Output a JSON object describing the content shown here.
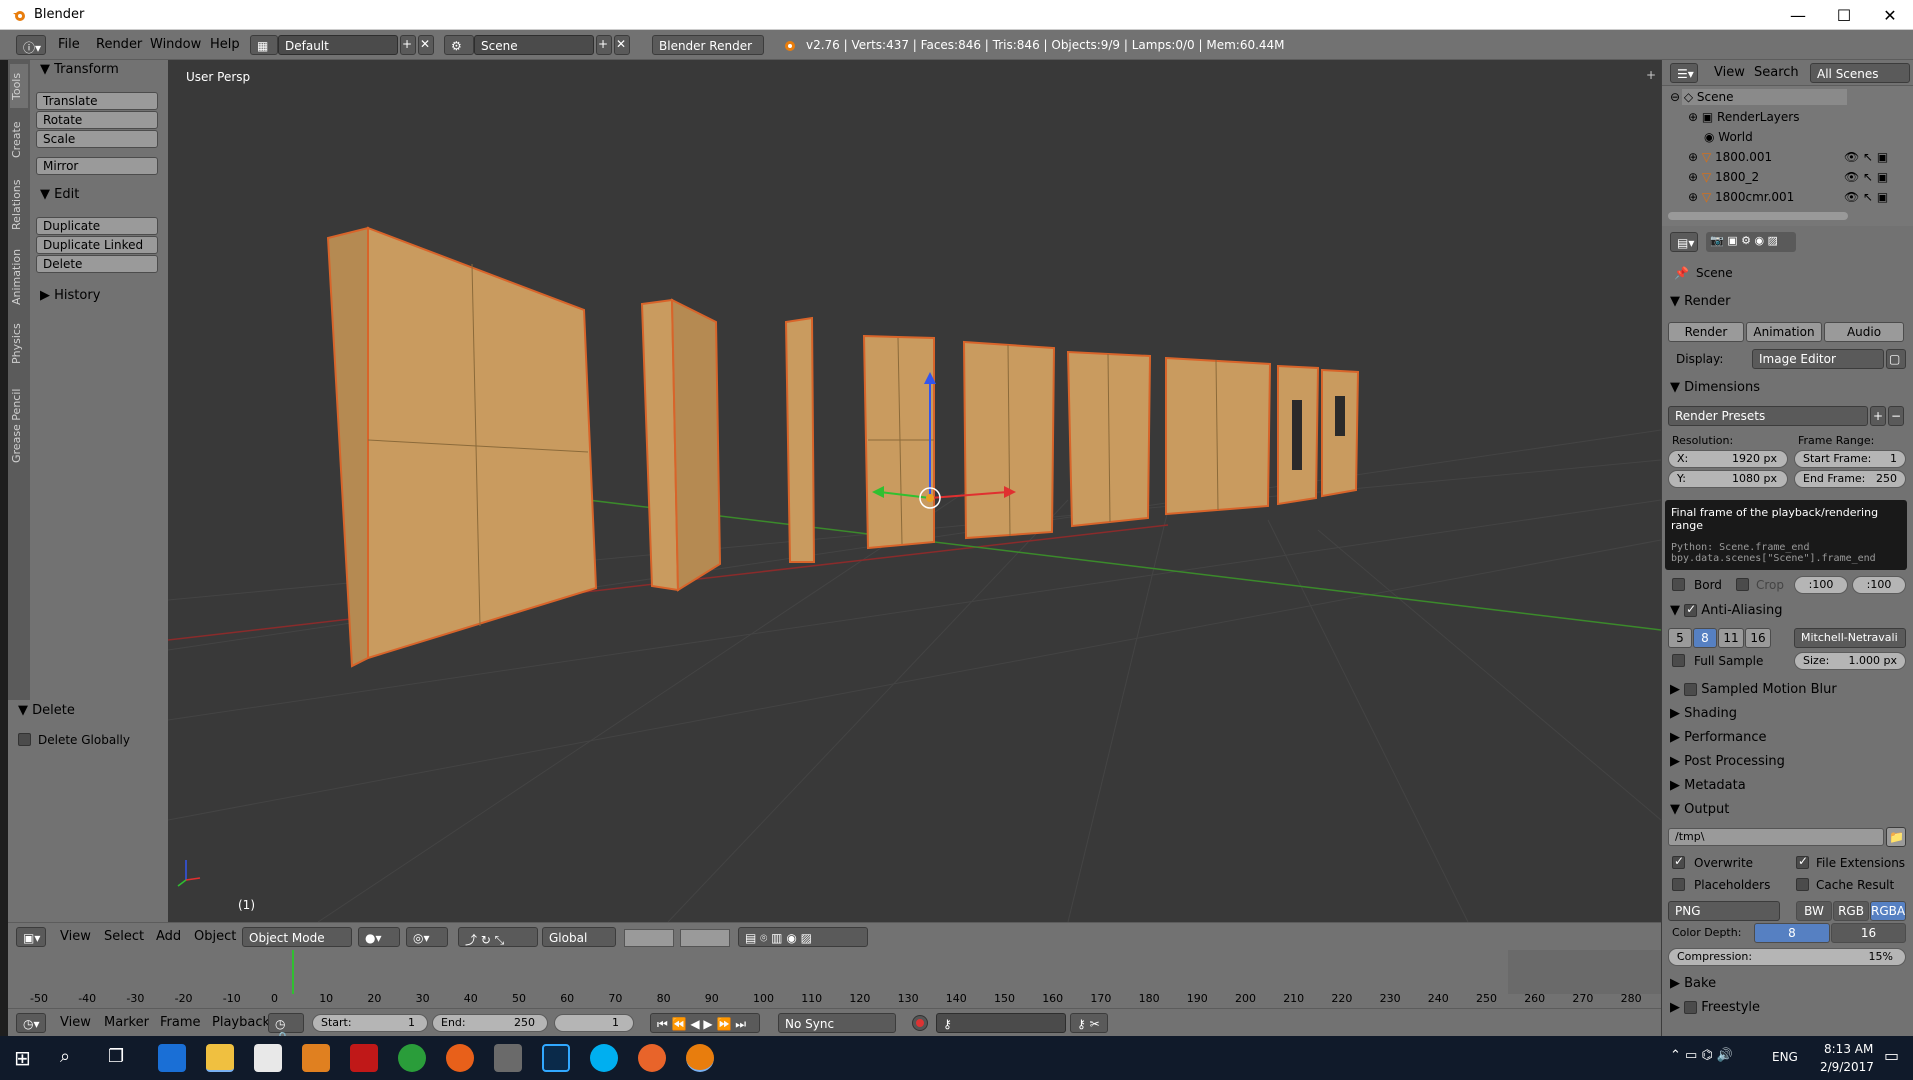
{
  "window": {
    "title": "Blender",
    "min": "—",
    "max": "☐",
    "close": "✕"
  },
  "infobar": {
    "menus": [
      "File",
      "Render",
      "Window",
      "Help"
    ],
    "layout": "Default",
    "scene": "Scene",
    "engine": "Blender Render",
    "stats": "v2.76 | Verts:437 | Faces:846 | Tris:846 | Objects:9/9 | Lamps:0/0 | Mem:60.44M"
  },
  "left_tabs": [
    "Tools",
    "Create",
    "Relations",
    "Animation",
    "Physics",
    "Grease Pencil"
  ],
  "toolshelf": {
    "transform_header": "Transform",
    "transform_buttons": [
      "Translate",
      "Rotate",
      "Scale",
      "Mirror"
    ],
    "edit_header": "Edit",
    "edit_buttons": [
      "Duplicate",
      "Duplicate Linked",
      "Delete"
    ],
    "history_header": "History"
  },
  "operator_panel": {
    "header": "Delete",
    "option": "Delete Globally"
  },
  "viewport": {
    "label": "User Persp",
    "frame_label": "(1)"
  },
  "viewport_header": {
    "menus": [
      "View",
      "Select",
      "Add",
      "Object"
    ],
    "mode": "Object Mode",
    "orientation": "Global"
  },
  "timeline": {
    "ruler": [
      "-50",
      "-40",
      "-30",
      "-20",
      "-10",
      "0",
      "10",
      "20",
      "30",
      "40",
      "50",
      "60",
      "70",
      "80",
      "90",
      "100",
      "110",
      "120",
      "130",
      "140",
      "150",
      "160",
      "170",
      "180",
      "190",
      "200",
      "210",
      "220",
      "230",
      "240",
      "250",
      "260",
      "270",
      "280"
    ],
    "menus": [
      "View",
      "Marker",
      "Frame",
      "Playback"
    ],
    "start_label": "Start:",
    "start_value": "1",
    "end_label": "End:",
    "end_value": "250",
    "current": "1",
    "sync": "No Sync"
  },
  "outliner": {
    "menus": [
      "View",
      "Search"
    ],
    "filter": "All Scenes",
    "items": [
      "Scene",
      "RenderLayers",
      "World",
      "1800.001",
      "1800_2",
      "1800cmr.001"
    ]
  },
  "properties": {
    "context": "Scene",
    "render_header": "Render",
    "render_buttons": [
      "Render",
      "Animation",
      "Audio"
    ],
    "display_label": "Display:",
    "display_value": "Image Editor",
    "dimensions_header": "Dimensions",
    "presets": "Render Presets",
    "resolution_label": "Resolution:",
    "res_x": "X:",
    "res_x_val": "1920 px",
    "res_y": "Y:",
    "res_y_val": "1080 px",
    "frame_range_label": "Frame Range:",
    "start_frame": "Start Frame:",
    "start_frame_val": "1",
    "end_frame": "End Frame:",
    "end_frame_val": "250",
    "bord": "Bord",
    "crop": "Crop",
    "remap_old": ":100",
    "remap_new": ":100",
    "aa_header": "Anti-Aliasing",
    "aa_samples": [
      "5",
      "8",
      "11",
      "16"
    ],
    "aa_filter": "Mitchell-Netravali",
    "full_sample": "Full Sample",
    "size_label": "Size:",
    "size_val": "1.000 px",
    "collapsed": [
      "Sampled Motion Blur",
      "Shading",
      "Performance",
      "Post Processing",
      "Metadata"
    ],
    "output_header": "Output",
    "output_path": "/tmp\\",
    "overwrite": "Overwrite",
    "file_ext": "File Extensions",
    "placeholders": "Placeholders",
    "cache_result": "Cache Result",
    "format": "PNG",
    "color_modes": [
      "BW",
      "RGB",
      "RGBA"
    ],
    "color_depth_label": "Color Depth:",
    "depth_8": "8",
    "depth_16": "16",
    "compression_label": "Compression:",
    "compression_val": "15%",
    "bake": "Bake",
    "freestyle": "Freestyle"
  },
  "tooltip": {
    "title": "Final frame of the playback/rendering range",
    "python1": "Python: Scene.frame_end",
    "python2": "bpy.data.scenes[\"Scene\"].frame_end"
  },
  "taskbar": {
    "time": "8:13 AM",
    "date": "2/9/2017",
    "lang": "ENG"
  }
}
